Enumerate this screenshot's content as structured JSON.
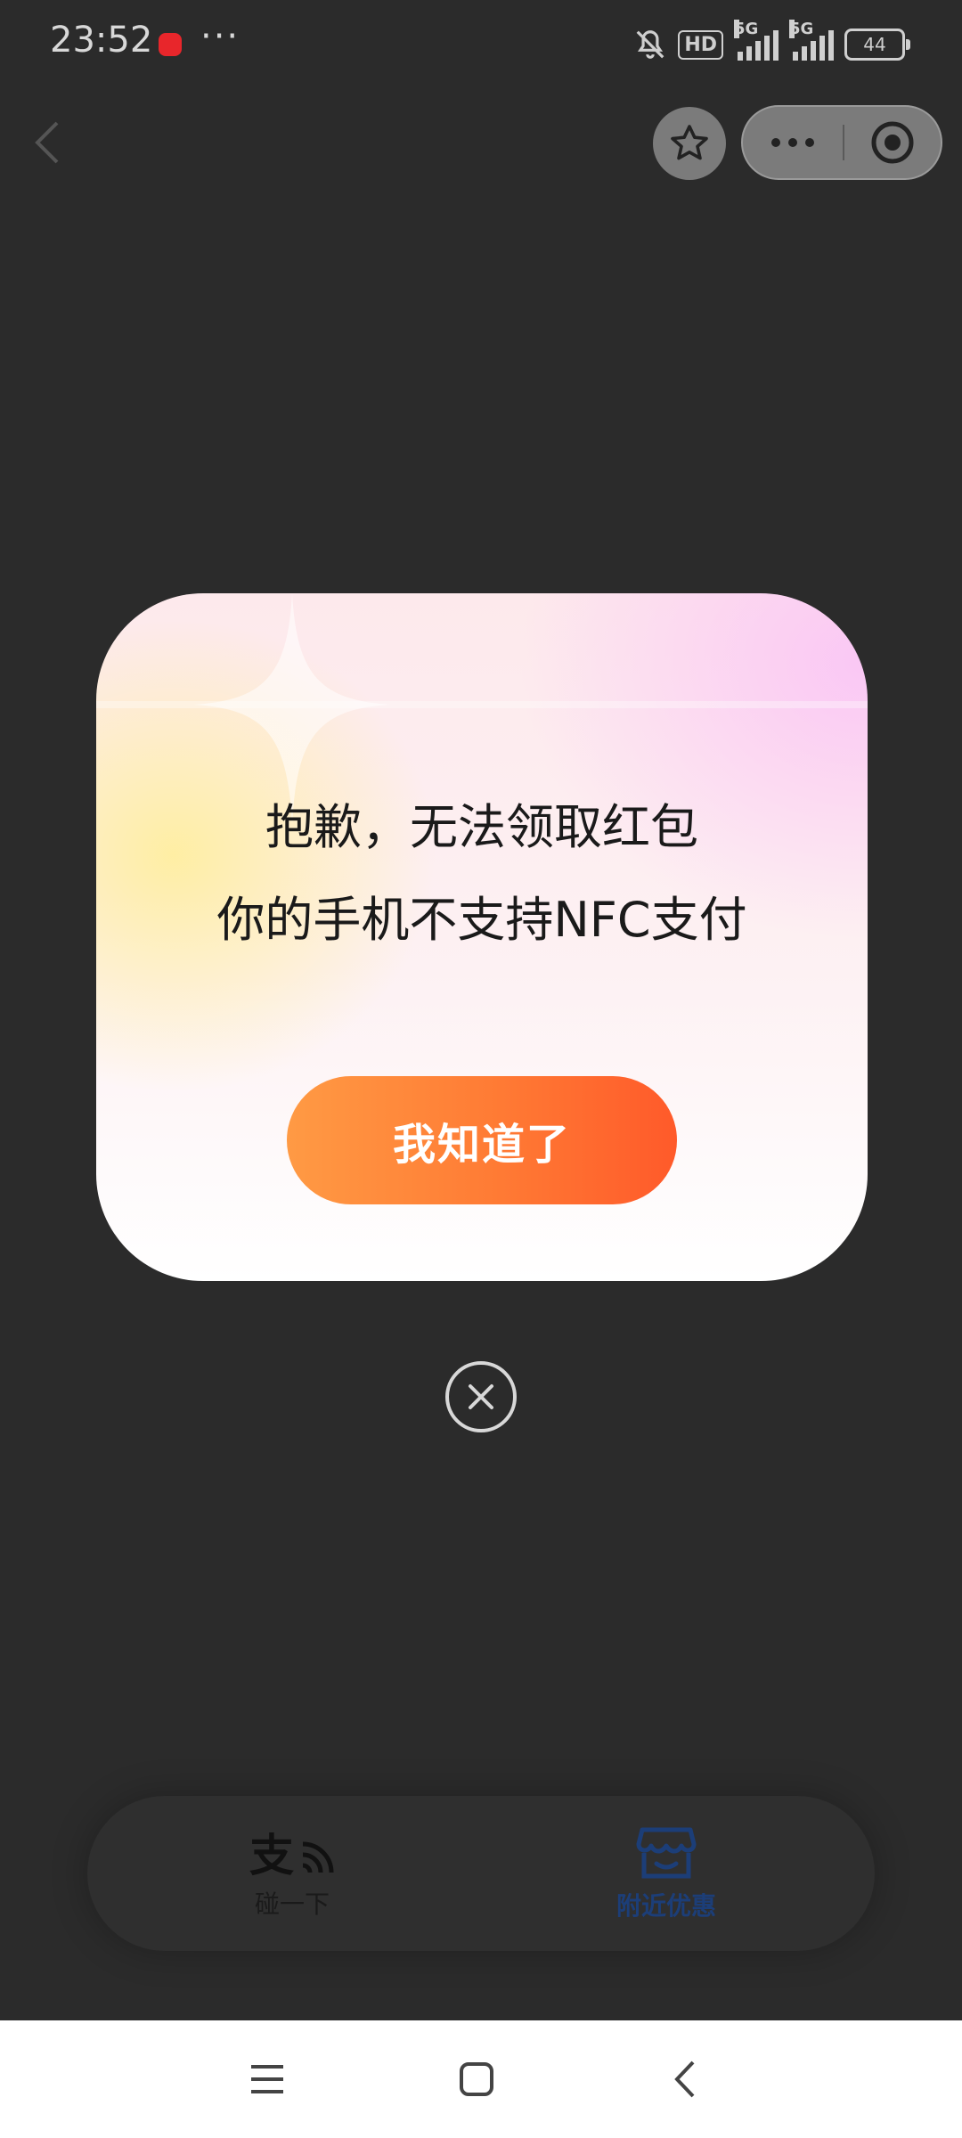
{
  "status_bar": {
    "time": "23:52",
    "dots": "···",
    "hd_badge": "HD",
    "network_label_1": "5G",
    "network_label_2": "5G",
    "battery_level": "44"
  },
  "dialog": {
    "line1": "抱歉，无法领取红包",
    "line2": "你的手机不支持NFC支付",
    "confirm_label": "我知道了"
  },
  "tabbar": {
    "left_label": "碰一下",
    "right_label": "附近优惠"
  },
  "colors": {
    "confirm_start": "#ff9a44",
    "confirm_end": "#ff5a2a",
    "active_tab": "#1c3e78"
  }
}
